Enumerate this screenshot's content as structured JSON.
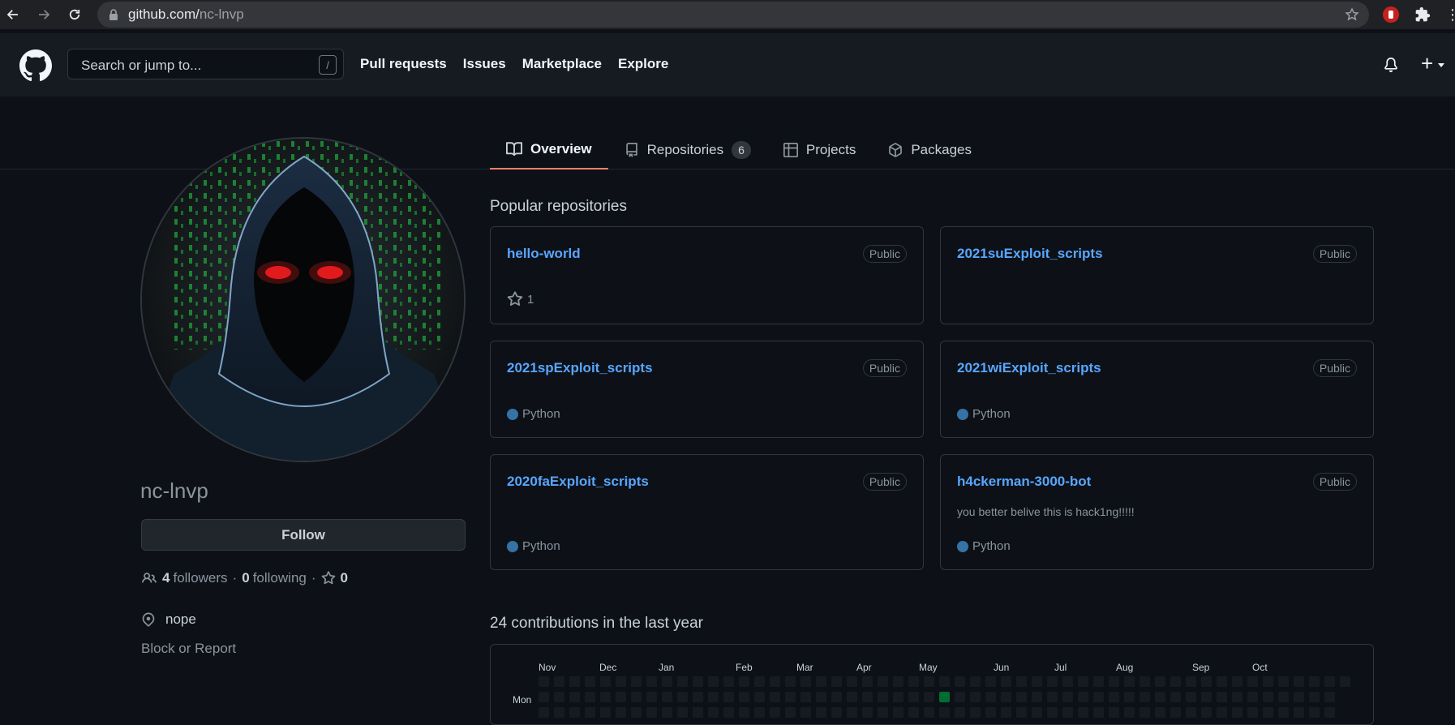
{
  "browser": {
    "url_host": "github.com/",
    "url_path": "nc-lnvp"
  },
  "header": {
    "search_placeholder": "Search or jump to...",
    "search_key": "/",
    "nav": [
      "Pull requests",
      "Issues",
      "Marketplace",
      "Explore"
    ]
  },
  "tabs": {
    "overview": "Overview",
    "repositories": "Repositories",
    "repositories_count": "6",
    "projects": "Projects",
    "packages": "Packages"
  },
  "profile": {
    "username": "nc-lnvp",
    "follow_label": "Follow",
    "followers_count": "4",
    "followers_label": "followers",
    "following_count": "0",
    "following_label": "following",
    "stars_count": "0",
    "location": "nope",
    "block_label": "Block or Report"
  },
  "popular": {
    "title": "Popular repositories",
    "repos": [
      {
        "name": "hello-world",
        "badge": "Public",
        "stars": "1"
      },
      {
        "name": "2021suExploit_scripts",
        "badge": "Public"
      },
      {
        "name": "2021spExploit_scripts",
        "badge": "Public",
        "language": "Python"
      },
      {
        "name": "2021wiExploit_scripts",
        "badge": "Public",
        "language": "Python"
      },
      {
        "name": "2020faExploit_scripts",
        "badge": "Public",
        "language": "Python"
      },
      {
        "name": "h4ckerman-3000-bot",
        "badge": "Public",
        "description": "you better belive this is hack1ng!!!!!",
        "language": "Python"
      }
    ]
  },
  "contributions": {
    "title": "24 contributions in the last year",
    "months": [
      "Nov",
      "Dec",
      "Jan",
      "Feb",
      "Mar",
      "Apr",
      "May",
      "Jun",
      "Jul",
      "Aug",
      "Sep",
      "Oct"
    ],
    "day_label": "Mon",
    "highlight_week": 26
  },
  "colors": {
    "link": "#58a6ff",
    "python": "#3572A5",
    "active_tab": "#f78166",
    "contrib_level1": "#0e4429",
    "contrib_level2": "#006d32",
    "contrib_level3": "#26a641"
  }
}
